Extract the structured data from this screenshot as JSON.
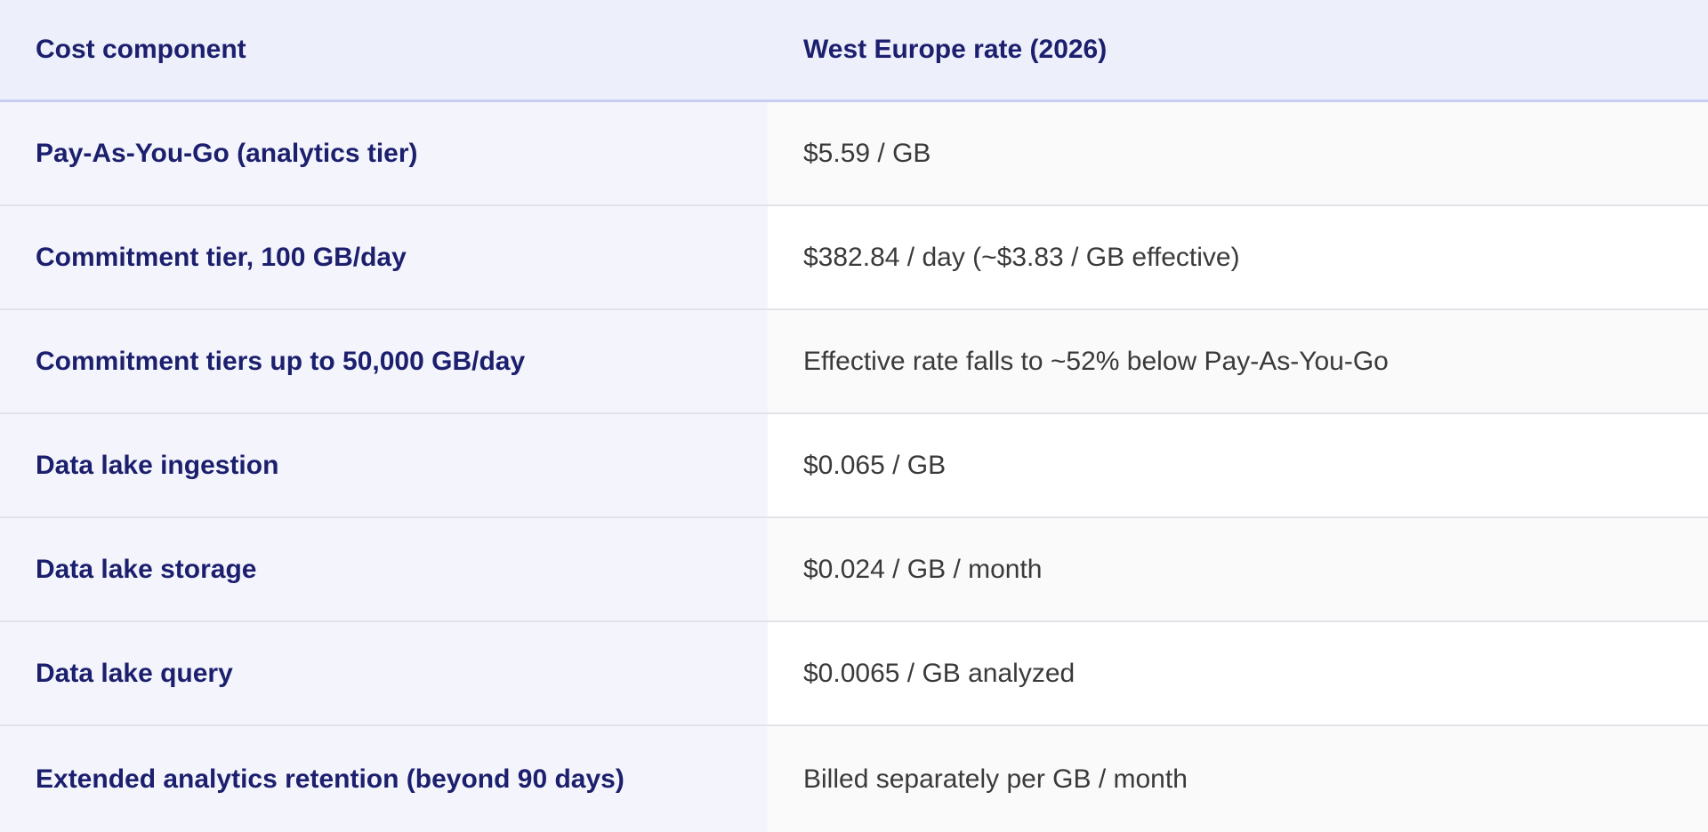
{
  "table": {
    "headers": [
      "Cost component",
      "West Europe rate (2026)"
    ],
    "rows": [
      {
        "component": "Pay-As-You-Go (analytics tier)",
        "rate": "$5.59 / GB"
      },
      {
        "component": "Commitment tier, 100 GB/day",
        "rate": "$382.84 / day (~$3.83 / GB effective)"
      },
      {
        "component": "Commitment tiers up to 50,000 GB/day",
        "rate": "Effective rate falls to ~52% below Pay-As-You-Go"
      },
      {
        "component": "Data lake ingestion",
        "rate": "$0.065 / GB"
      },
      {
        "component": "Data lake storage",
        "rate": "$0.024 / GB / month"
      },
      {
        "component": "Data lake query",
        "rate": "$0.0065 / GB analyzed"
      },
      {
        "component": "Extended analytics retention (beyond 90 days)",
        "rate": "Billed separately per GB / month"
      }
    ]
  },
  "colors": {
    "header_bg": "#edeffb",
    "header_text": "#1c1f6d",
    "label_bg": "#f4f5fc",
    "value_text": "#3a3a3a",
    "divider": "#e3e4ea"
  }
}
